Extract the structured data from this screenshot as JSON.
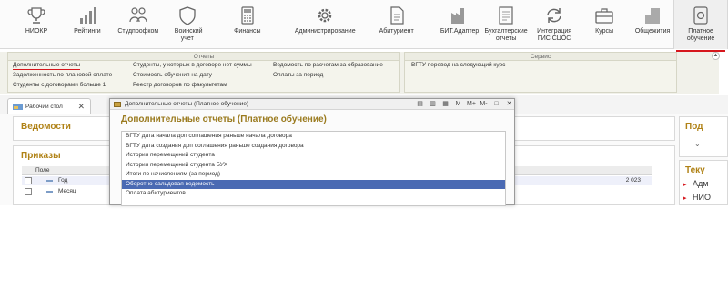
{
  "sections": [
    {
      "id": "niokr",
      "label": "НИОКР",
      "icon": "trophy-icon"
    },
    {
      "id": "ratings",
      "label": "Рейтинги",
      "icon": "bar-chart-icon"
    },
    {
      "id": "studprofkom",
      "label": "Студпрофком",
      "icon": "people-icon"
    },
    {
      "id": "military",
      "label": "Воинский учет",
      "icon": "shield-icon"
    },
    {
      "id": "finance",
      "label": "Финансы",
      "icon": "calculator-icon"
    },
    {
      "id": "admin",
      "label": "Администрирование",
      "icon": "gear-icon"
    },
    {
      "id": "abiturient",
      "label": "Абитуриент",
      "icon": "document-icon"
    },
    {
      "id": "bit",
      "label": "БИТ.Адаптер",
      "icon": "factory-icon"
    },
    {
      "id": "accounting",
      "label": "Бухгалтерские отчеты",
      "icon": "report-icon"
    },
    {
      "id": "gis",
      "label": "Интеграция ГИС СЦОС",
      "icon": "sync-icon"
    },
    {
      "id": "courses",
      "label": "Курсы",
      "icon": "briefcase-icon"
    },
    {
      "id": "dorms",
      "label": "Общежития",
      "icon": "building-icon"
    },
    {
      "id": "paid",
      "label": "Платное обучение",
      "icon": "money-icon"
    }
  ],
  "commands": {
    "reports_header": "Отчеты",
    "service_header": "Сервис",
    "col1": [
      "Дополнительные отчеты",
      "Задолженность по плановой оплате",
      "Студенты с договорами больше 1"
    ],
    "col2": [
      "Студенты, у которых в договоре нет суммы",
      "Стоимость обучения на дату",
      "Реестр договоров по факультетам"
    ],
    "col3": [
      "Ведомость по расчетам за образование",
      "Оплаты за период"
    ],
    "service": [
      "ВГТУ перевод на следующий курс"
    ]
  },
  "tabs": [
    {
      "label": "Рабочий стол",
      "close": "✕"
    }
  ],
  "workspace": {
    "vedomosti_title": "Ведомости",
    "prikazy_title": "Приказы",
    "grid_header": "Поле",
    "rows": [
      {
        "label": "Год",
        "value": "2 023"
      },
      {
        "label": "Месяц",
        "value": ""
      }
    ],
    "right_title1": "Под",
    "right_title2": "Теку",
    "right_items": [
      "Адм",
      "НИО"
    ]
  },
  "dialog": {
    "title": "Дополнительные отчеты (Платное обучение)",
    "heading": "Дополнительные отчеты (Платное обучение)",
    "toolbar": [
      "M",
      "M+",
      "M-",
      "□",
      "✕"
    ],
    "items": [
      "ВГТУ дата начала доп соглашения раньше начала договора",
      "ВГТУ дата создания доп соглашения раньше создания договора",
      "История перемещений студента",
      "История перемещений студента БУХ",
      "Итоги по начислениям (за период)",
      "Оборотно-сальдовая ведомость",
      "Оплата абитуриентов"
    ],
    "selected_index": 5
  },
  "colors": {
    "accent": "#d6171d",
    "title": "#b08216",
    "selection": "#4a6ab3"
  }
}
